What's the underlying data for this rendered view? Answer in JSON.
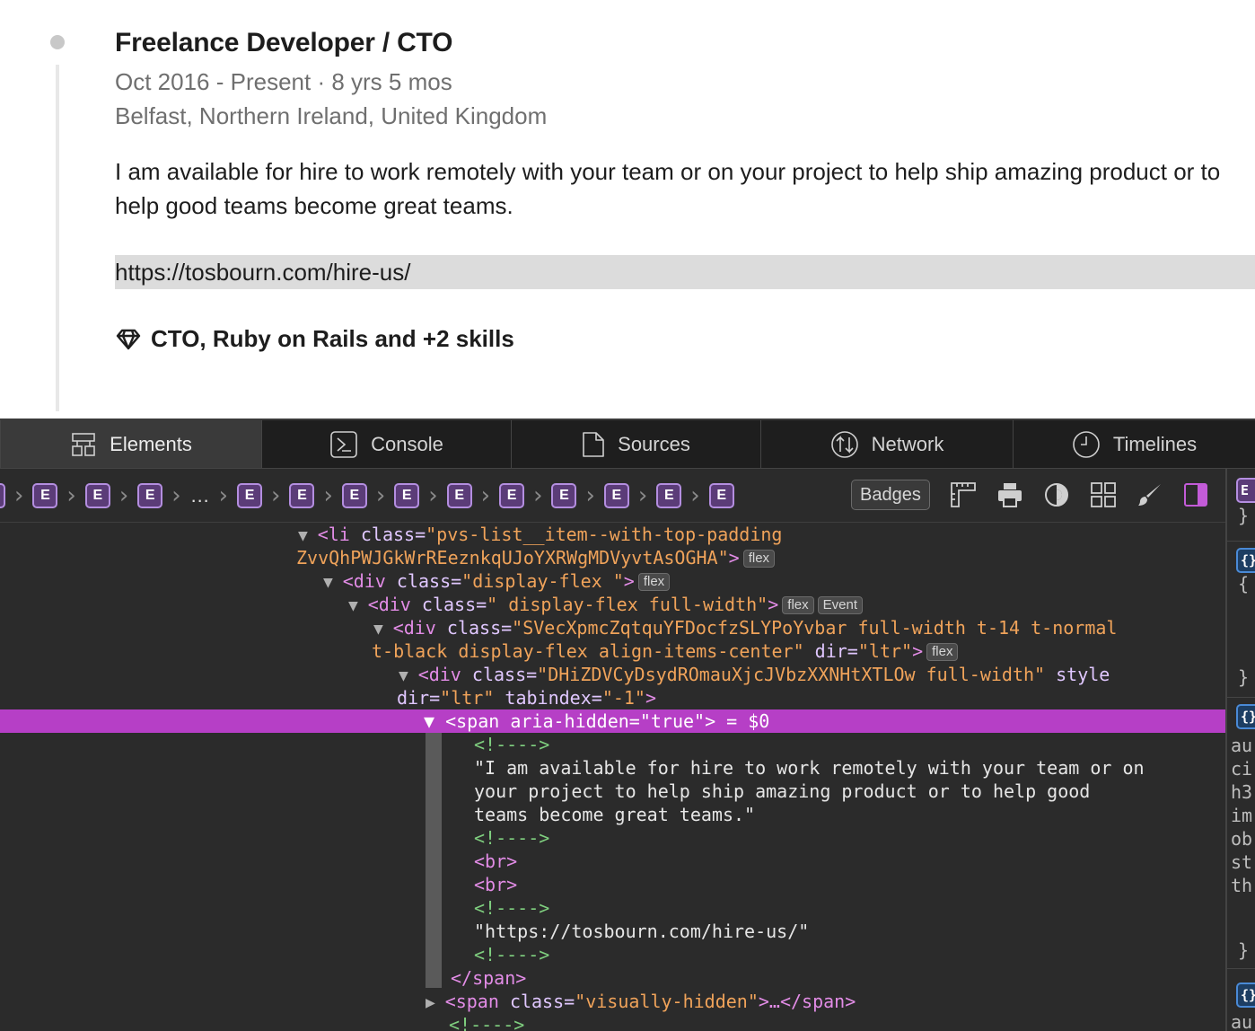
{
  "experience": {
    "title": "Freelance Developer / CTO",
    "dates": "Oct 2016 - Present · 8 yrs 5 mos",
    "location": "Belfast, Northern Ireland, United Kingdom",
    "description_line1": "I am available for hire to work remotely with your team or on your project to help ship amazing product or to",
    "description_line2": "help good teams become great teams.",
    "link": "https://tosbourn.com/hire-us/",
    "skills": "CTO, Ruby on Rails and +2 skills",
    "skills_icon": "diamond-icon"
  },
  "devtools": {
    "tabs": [
      {
        "label": "Elements",
        "icon": "elements-icon",
        "active": true
      },
      {
        "label": "Console",
        "icon": "console-icon",
        "active": false
      },
      {
        "label": "Sources",
        "icon": "sources-icon",
        "active": false
      },
      {
        "label": "Network",
        "icon": "network-icon",
        "active": false
      },
      {
        "label": "Timelines",
        "icon": "timelines-icon",
        "active": false
      }
    ],
    "breadcrumb_badge": "E",
    "breadcrumb_ellipsis": "…",
    "toolbar": {
      "badges_label": "Badges"
    },
    "dom": {
      "l1_open": "<li ",
      "l1_attr": "class=",
      "l1_val": "\"pvs-list__item--with-top-padding",
      "l2_val": "ZvvQhPWJGkWrREeznkqUJoYXRWgMDVyvtAsOGHA\"",
      "l2_close": ">",
      "l2_pill": "flex",
      "l3_tag": "<div ",
      "l3_attr": "class=",
      "l3_val": "\"display-flex \"",
      "l3_close": ">",
      "l3_pill": "flex",
      "l4_tag": "<div ",
      "l4_attr": "class=",
      "l4_val": "\" display-flex full-width\"",
      "l4_close": ">",
      "l4_pill1": "flex",
      "l4_pill2": "Event",
      "l5_tag": "<div ",
      "l5_attr": "class=",
      "l5_val": "\"SVecXpmcZqtquYFDocfzSLYPoYvbar full-width t-14 t-normal",
      "l6_val": "t-black display-flex align-items-center\"",
      "l6_attr": " dir=",
      "l6_attrval": "\"ltr\"",
      "l6_close": ">",
      "l6_pill": "flex",
      "l7_tag": "<div ",
      "l7_attr": "class=",
      "l7_val": "\"DHiZDVCyDsydROmauXjcJVbzXXNHtXTLOw full-width\"",
      "l7_attr2": " style",
      "l8_attr": "dir=",
      "l8_val": "\"ltr\"",
      "l8_attr2": " tabindex=",
      "l8_val2": "\"-1\"",
      "l8_close": ">",
      "sel_line": "<span aria-hidden=\"true\"> = $0",
      "c1": "<!---->",
      "t1": "\"I am available for hire to work remotely with your team or on",
      "t2": "your project to help ship amazing product or to help good",
      "t3": "teams become great teams.\"",
      "c2": "<!---->",
      "br1": "<br>",
      "br2": "<br>",
      "c3": "<!---->",
      "url": "\"https://tosbourn.com/hire-us/\"",
      "c4": "<!---->",
      "span_close": "</span>",
      "vh_open": "<span ",
      "vh_attr": "class=",
      "vh_val": "\"visually-hidden\"",
      "vh_rest": ">…</span>",
      "c5": "<!---->"
    },
    "side": {
      "badge1": "E",
      "brace_close": "}",
      "badge2": "{}",
      "brace_open": "{",
      "frag1": "au",
      "frag2": "ci",
      "frag3": "h3",
      "frag4": "im",
      "frag5": "ob",
      "frag6": "st",
      "frag7": "th",
      "frag8": "au"
    }
  }
}
